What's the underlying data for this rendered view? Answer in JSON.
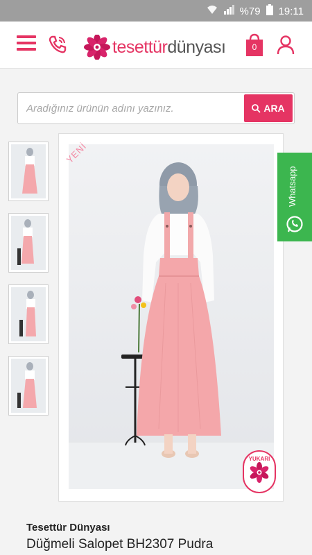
{
  "status_bar": {
    "battery_text": "%79",
    "time": "19:11"
  },
  "header": {
    "logo": {
      "text_pink": "tesettür",
      "text_gray": "dünyası"
    },
    "cart_count": "0",
    "icons": {
      "menu": "hamburger-menu-icon",
      "phone": "phone-icon",
      "cart": "shopping-bag-icon",
      "user": "user-icon"
    }
  },
  "search": {
    "placeholder": "Aradığınız ürünün adını yazınız.",
    "button_label": "ARA"
  },
  "gallery": {
    "badge": "YENİ",
    "thumbnails": [
      "thumb-1",
      "thumb-2",
      "thumb-3",
      "thumb-4"
    ]
  },
  "whatsapp": {
    "label": "Whatsapp"
  },
  "scroll_top": {
    "label": "YUKARI"
  },
  "product": {
    "brand": "Tesettür Dünyası",
    "title": "Düğmeli Salopet BH2307 Pudra"
  },
  "colors": {
    "brand_pink": "#e53463",
    "whatsapp_green": "#3cb64f",
    "status_gray": "#9e9e9e"
  }
}
